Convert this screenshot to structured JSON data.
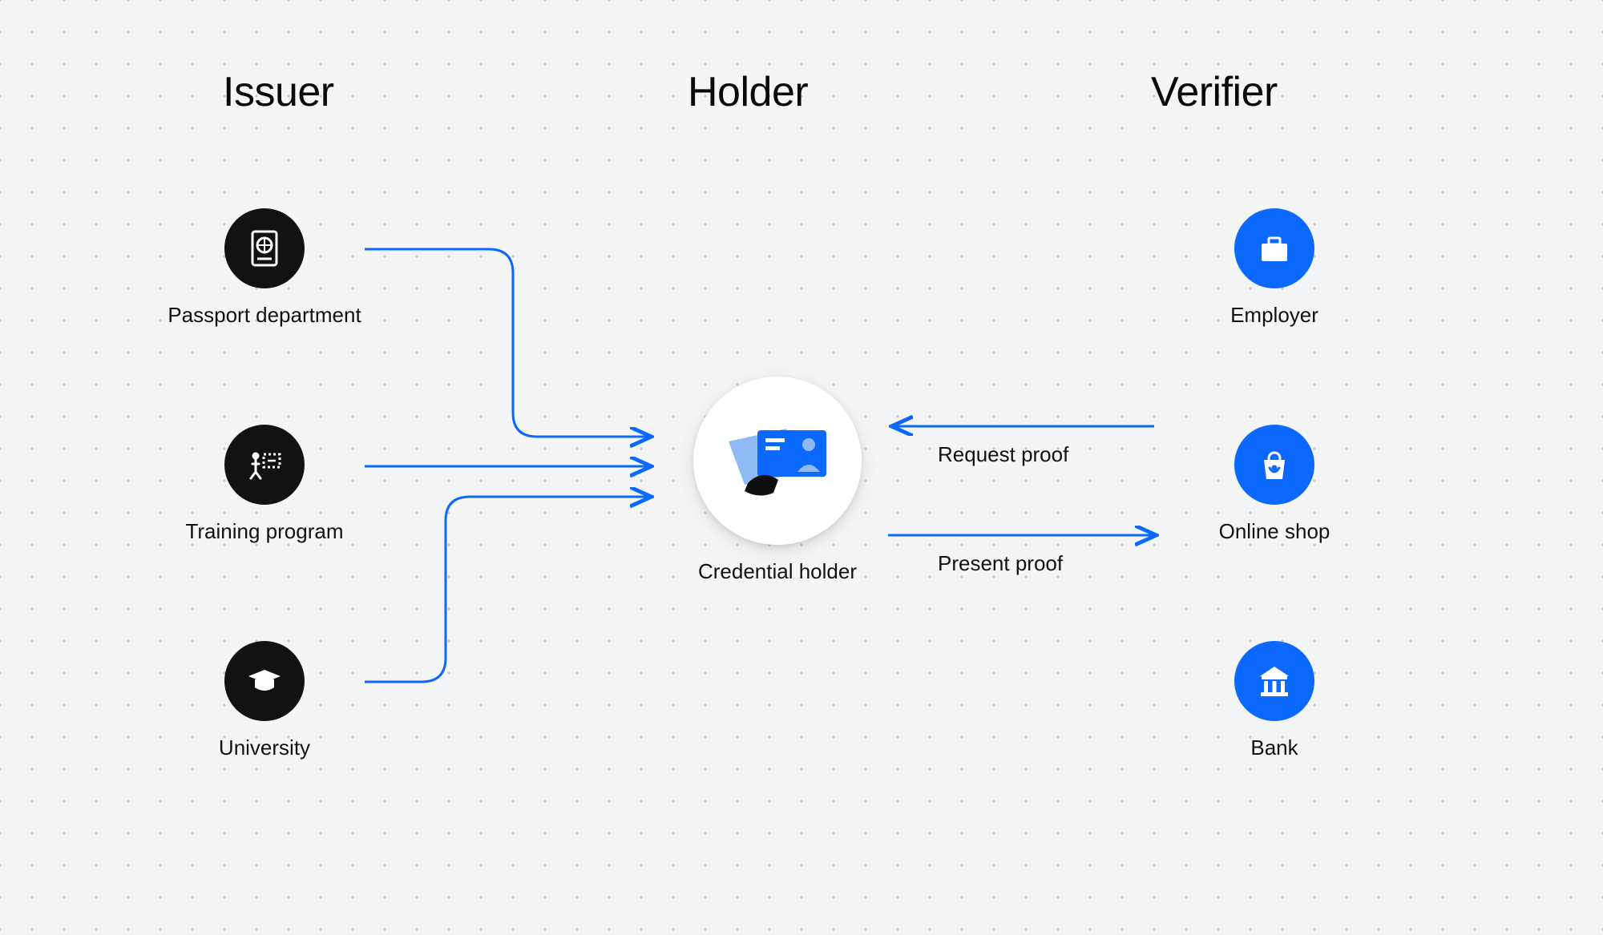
{
  "headings": {
    "issuer": "Issuer",
    "holder": "Holder",
    "verifier": "Verifier"
  },
  "issuers": [
    {
      "label": "Passport department",
      "icon": "passport-icon"
    },
    {
      "label": "Training program",
      "icon": "presentation-icon"
    },
    {
      "label": "University",
      "icon": "graduation-icon"
    }
  ],
  "holder": {
    "label": "Credential holder",
    "icon": "credential-card-icon"
  },
  "verifiers": [
    {
      "label": "Employer",
      "icon": "briefcase-icon"
    },
    {
      "label": "Online shop",
      "icon": "shopping-bag-icon"
    },
    {
      "label": "Bank",
      "icon": "bank-icon"
    }
  ],
  "flows": {
    "request": "Request proof",
    "present": "Present proof"
  },
  "colors": {
    "arrow": "#0b69ff",
    "issuerCircle": "#121212",
    "verifierCircle": "#0b69ff",
    "holderBg": "#ffffff",
    "canvasBg": "#f4f5f6",
    "dot": "#c4c7cb"
  }
}
